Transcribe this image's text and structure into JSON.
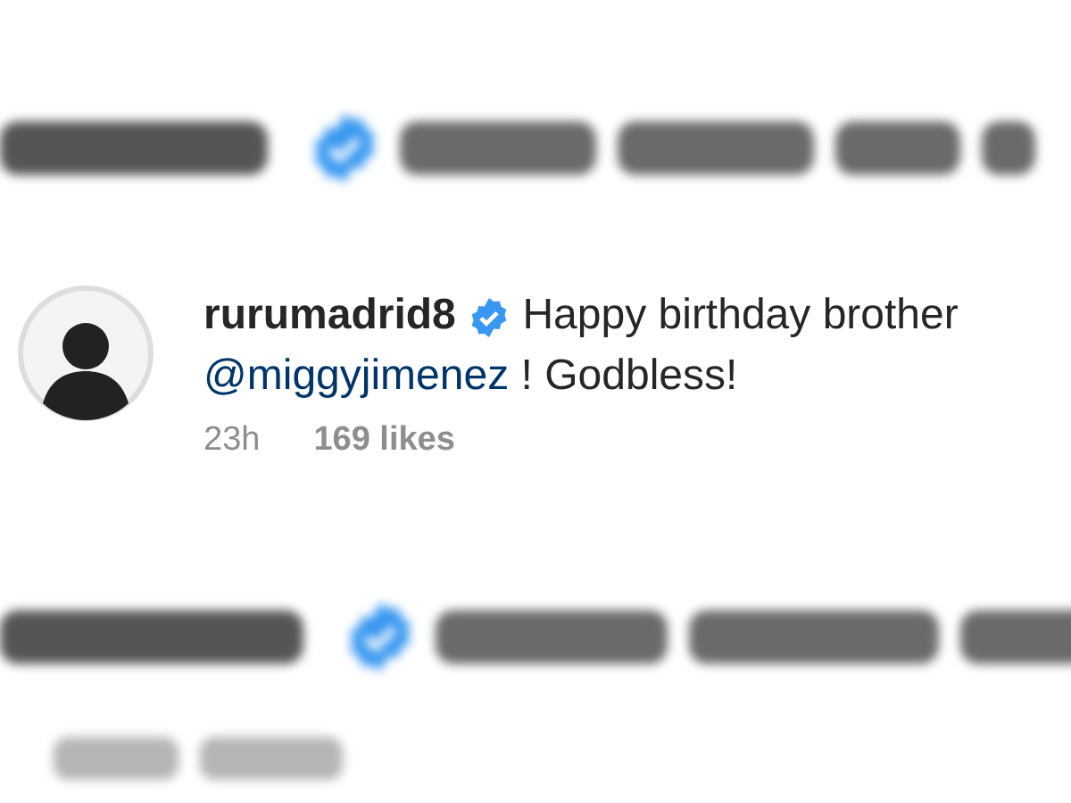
{
  "comments": [
    {
      "kind": "blurred",
      "verified": true
    },
    {
      "kind": "full",
      "username": "rurumadrid8",
      "verified": true,
      "text_before": "Happy birthday brother",
      "mention": "@miggyjimenez",
      "text_after": "! Godbless!",
      "time": "23h",
      "likes": "169 likes"
    },
    {
      "kind": "blurred_with_meta",
      "verified": true
    }
  ]
}
